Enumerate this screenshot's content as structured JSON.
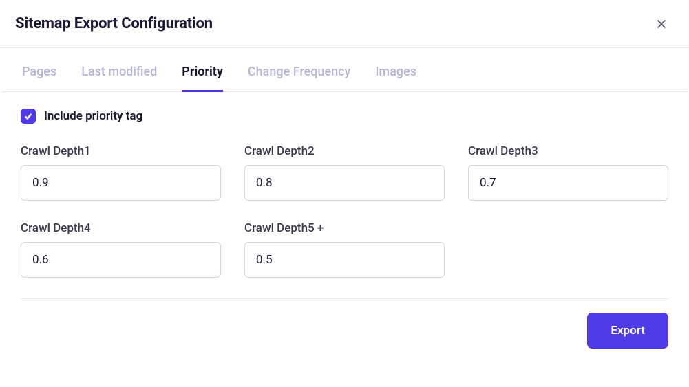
{
  "header": {
    "title": "Sitemap Export Configuration"
  },
  "tabs": [
    {
      "label": "Pages",
      "active": false
    },
    {
      "label": "Last modified",
      "active": false
    },
    {
      "label": "Priority",
      "active": true
    },
    {
      "label": "Change Frequency",
      "active": false
    },
    {
      "label": "Images",
      "active": false
    }
  ],
  "checkbox": {
    "checked": true,
    "label": "Include priority tag"
  },
  "fields": [
    {
      "label": "Crawl Depth1",
      "value": "0.9"
    },
    {
      "label": "Crawl Depth2",
      "value": "0.8"
    },
    {
      "label": "Crawl Depth3",
      "value": "0.7"
    },
    {
      "label": "Crawl Depth4",
      "value": "0.6"
    },
    {
      "label": "Crawl Depth5 +",
      "value": "0.5"
    }
  ],
  "footer": {
    "export_label": "Export"
  }
}
